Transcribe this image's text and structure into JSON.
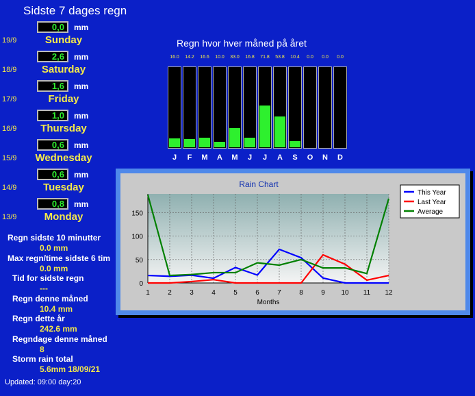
{
  "title": "Sidste 7 dages regn",
  "unit": "mm",
  "days": [
    {
      "date": "19/9",
      "value": "0,0",
      "name": "Sunday"
    },
    {
      "date": "18/9",
      "value": "2,6",
      "name": "Saturday"
    },
    {
      "date": "17/9",
      "value": "1,6",
      "name": "Friday"
    },
    {
      "date": "16/9",
      "value": "1,0",
      "name": "Thursday"
    },
    {
      "date": "15/9",
      "value": "0,6",
      "name": "Wednesday"
    },
    {
      "date": "14/9",
      "value": "0,6",
      "name": "Tuesday"
    },
    {
      "date": "13/9",
      "value": "0,8",
      "name": "Monday"
    }
  ],
  "stats": [
    {
      "label": "Regn sidste 10 minutter",
      "value": "0.0 mm"
    },
    {
      "label": "Max regn/time sidste 6 tim",
      "value": "0.0 mm"
    },
    {
      "label": "Tid for sidste regn",
      "value": "---"
    },
    {
      "label": "Regn denne måned",
      "value": "10.4 mm"
    },
    {
      "label": "Regn dette år",
      "value": "242.6 mm"
    },
    {
      "label": "Regndage denne måned",
      "value": "8"
    },
    {
      "label": "Storm rain total",
      "value": "5.6mm 18/09/21"
    }
  ],
  "updated": "Updated: 09:00 day:20",
  "monthly": {
    "title": "Regn hvor hver måned på året",
    "labels": [
      "16.0",
      "14.2",
      "16.6",
      "10.0",
      "33.0",
      "16.8",
      "71.8",
      "53.8",
      "10.4",
      "0.0",
      "0.0",
      "0.0"
    ],
    "values": [
      16.0,
      14.2,
      16.6,
      10.0,
      33.0,
      16.8,
      71.8,
      53.8,
      10.4,
      0.0,
      0.0,
      0.0
    ],
    "months": [
      "J",
      "F",
      "M",
      "A",
      "M",
      "J",
      "J",
      "A",
      "S",
      "O",
      "N",
      "D"
    ]
  },
  "chart_data": {
    "type": "line",
    "title": "Rain Chart",
    "xlabel": "Months",
    "ylabel": "",
    "x": [
      1,
      2,
      3,
      4,
      5,
      6,
      7,
      8,
      9,
      10,
      11,
      12
    ],
    "xlim": [
      1,
      12
    ],
    "ylim": [
      0,
      190
    ],
    "yticks": [
      0,
      50,
      100,
      150
    ],
    "grid": true,
    "legend": "top-right",
    "series": [
      {
        "name": "This Year",
        "color": "#0000ff",
        "values": [
          16,
          14.2,
          16.6,
          10,
          33,
          16.8,
          71.8,
          53.8,
          10.4,
          0,
          0,
          0
        ]
      },
      {
        "name": "Last Year",
        "color": "#ff0000",
        "values": [
          0,
          0,
          3,
          7,
          0,
          0,
          0,
          0,
          60,
          40,
          6,
          16
        ]
      },
      {
        "name": "Average",
        "color": "#008000",
        "values": [
          188,
          16,
          18,
          22,
          22,
          43,
          38,
          50,
          32,
          32,
          20,
          180
        ]
      }
    ]
  }
}
